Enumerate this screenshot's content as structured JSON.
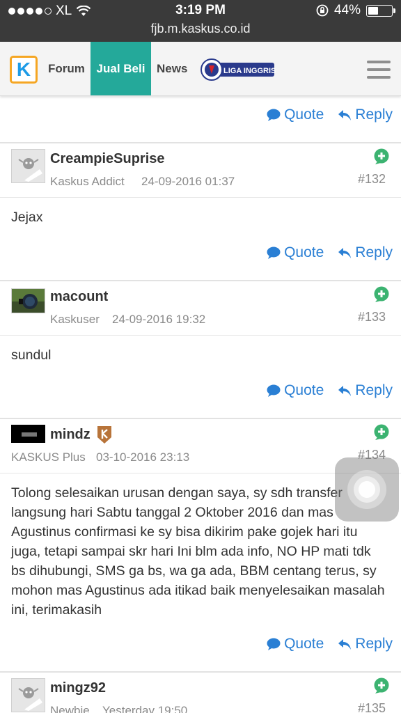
{
  "status_bar": {
    "carrier": "XL",
    "time": "3:19 PM",
    "battery": "44%",
    "battery_level": 0.44,
    "url": "fjb.m.kaskus.co.id"
  },
  "nav": {
    "logo": "K",
    "tabs": [
      "Forum",
      "Jual Beli",
      "News"
    ],
    "active_tab": "Jual Beli",
    "liga_logo_text": "LIGA INGGRIS"
  },
  "actions": {
    "quote": "Quote",
    "reply": "Reply"
  },
  "posts": [
    {
      "username": "CreampieSuprise",
      "rank": "Kaskus Addict",
      "date": "24-09-2016 01:37",
      "number": "#132",
      "body": "Jejax"
    },
    {
      "username": "macount",
      "rank": "Kaskuser",
      "date": "24-09-2016 19:32",
      "number": "#133",
      "body": "sundul"
    },
    {
      "username": "mindz",
      "rank": "KASKUS Plus",
      "date": "03-10-2016 23:13",
      "number": "#134",
      "body": "Tolong selesaikan urusan dengan saya, sy sdh transfer langsung hari Sabtu tanggal 2 Oktober 2016 dan mas Agustinus confirmasi ke sy bisa dikirim pake gojek hari itu juga, tetapi sampai skr hari Ini blm ada info, NO HP mati tdk bs dihubungi, SMS ga bs, wa ga ada, BBM centang terus, sy mohon mas Agustinus ada itikad baik menyelesaikan masalah ini, terimakasih"
    },
    {
      "username": "mingz92",
      "rank": "Newbie",
      "date": "Yesterday 19:50",
      "number": "#135",
      "body": ""
    }
  ],
  "colors": {
    "accent": "#24a99a",
    "link": "#2a7fd4",
    "plus": "#3cb371",
    "statusbar": "#3a3a3a"
  }
}
